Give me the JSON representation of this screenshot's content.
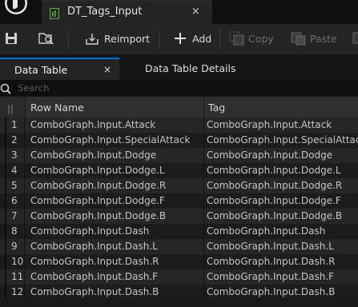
{
  "document_tab": {
    "label": "DT_Tags_Input",
    "close": "×"
  },
  "toolbar": {
    "reimport_label": "Reimport",
    "add_label": "Add",
    "copy_label": "Copy",
    "paste_label": "Paste"
  },
  "panel_tabs": {
    "data_table": "Data Table",
    "data_table_close": "×",
    "data_table_details": "Data Table Details"
  },
  "search": {
    "placeholder": "Search"
  },
  "table": {
    "columns": [
      "Row Name",
      "Tag"
    ],
    "rows": [
      {
        "index": "1",
        "name": "ComboGraph.Input.Attack",
        "tag": "ComboGraph.Input.Attack"
      },
      {
        "index": "2",
        "name": "ComboGraph.Input.SpecialAttack",
        "tag": "ComboGraph.Input.SpecialAttack"
      },
      {
        "index": "3",
        "name": "ComboGraph.Input.Dodge",
        "tag": "ComboGraph.Input.Dodge"
      },
      {
        "index": "4",
        "name": "ComboGraph.Input.Dodge.L",
        "tag": "ComboGraph.Input.Dodge.L"
      },
      {
        "index": "5",
        "name": "ComboGraph.Input.Dodge.R",
        "tag": "ComboGraph.Input.Dodge.R"
      },
      {
        "index": "6",
        "name": "ComboGraph.Input.Dodge.F",
        "tag": "ComboGraph.Input.Dodge.F"
      },
      {
        "index": "7",
        "name": "ComboGraph.Input.Dodge.B",
        "tag": "ComboGraph.Input.Dodge.B"
      },
      {
        "index": "8",
        "name": "ComboGraph.Input.Dash",
        "tag": "ComboGraph.Input.Dash"
      },
      {
        "index": "9",
        "name": "ComboGraph.Input.Dash.L",
        "tag": "ComboGraph.Input.Dash.L"
      },
      {
        "index": "10",
        "name": "ComboGraph.Input.Dash.R",
        "tag": "ComboGraph.Input.Dash.R"
      },
      {
        "index": "11",
        "name": "ComboGraph.Input.Dash.F",
        "tag": "ComboGraph.Input.Dash.F"
      },
      {
        "index": "12",
        "name": "ComboGraph.Input.Dash.B",
        "tag": "ComboGraph.Input.Dash.B"
      }
    ]
  },
  "colors": {
    "accent": "#0070e0",
    "asset_icon": "#5ea84a"
  }
}
